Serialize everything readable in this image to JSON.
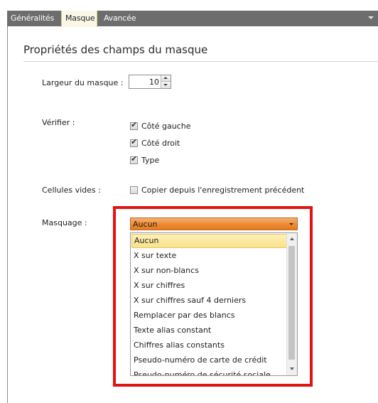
{
  "tabs": [
    {
      "label": "Généralités",
      "active": false
    },
    {
      "label": "Masque",
      "active": true
    },
    {
      "label": "Avancée",
      "active": false
    }
  ],
  "section": {
    "title": "Propriétés des champs du masque"
  },
  "mask_width": {
    "label": "Largeur du masque :",
    "value": "10"
  },
  "verify": {
    "label": "Vérifier :",
    "options": [
      {
        "label": "Côté gauche",
        "checked": true
      },
      {
        "label": "Côté droit",
        "checked": true
      },
      {
        "label": "Type",
        "checked": true
      }
    ]
  },
  "empty_cells": {
    "label": "Cellules vides :",
    "option_label": "Copier depuis l'enregistrement précédent",
    "checked": false
  },
  "masking": {
    "label": "Masquage :",
    "selected": "Aucun",
    "options": [
      "Aucun",
      "X sur texte",
      "X sur non-blancs",
      "X sur chiffres",
      "X sur chiffres sauf 4 derniers",
      "Remplacer par des blancs",
      "Texte alias constant",
      "Chiffres alias constants",
      "Pseudo-numéro de carte de crédit",
      "Pseudo-numéro de sécurité sociale"
    ]
  },
  "colors": {
    "highlight_frame": "#e11313",
    "combo_fill": "#ee8a32",
    "selected_item": "#f9e28a",
    "tab_bar": "#6d6d6d"
  }
}
